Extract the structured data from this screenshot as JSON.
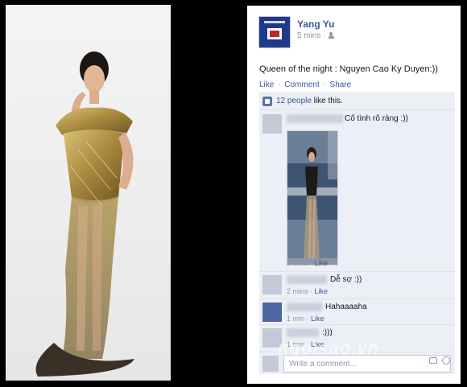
{
  "post": {
    "author": "Yang Yu",
    "time": "5 mins",
    "meta_sep": "·",
    "text": "Queen of the night : Nguyen Cao Ky Duyen:))",
    "actions": {
      "like": "Like",
      "comment": "Comment",
      "share": "Share",
      "dot": "·"
    }
  },
  "likes": {
    "count_label": "12 people",
    "suffix": " like this."
  },
  "comments": [
    {
      "text": "Cố tình rõ ràng :))",
      "time": "5 mins",
      "like": "Like"
    },
    {
      "text": "Dễ sợ :))",
      "time": "2 mins",
      "like": "Like"
    },
    {
      "text": "Hahaaaaha",
      "time": "1 min",
      "like": "Like"
    },
    {
      "text": ":)))",
      "time": "1 min",
      "like": "Like"
    }
  ],
  "comment_sep": " · ",
  "write_placeholder": "Write a comment...",
  "watermark": "ngoisao.vn",
  "colors": {
    "facebook_blue": "#3b5998",
    "ufi_background": "#eceff5",
    "gown_gold": "#b8974a"
  }
}
